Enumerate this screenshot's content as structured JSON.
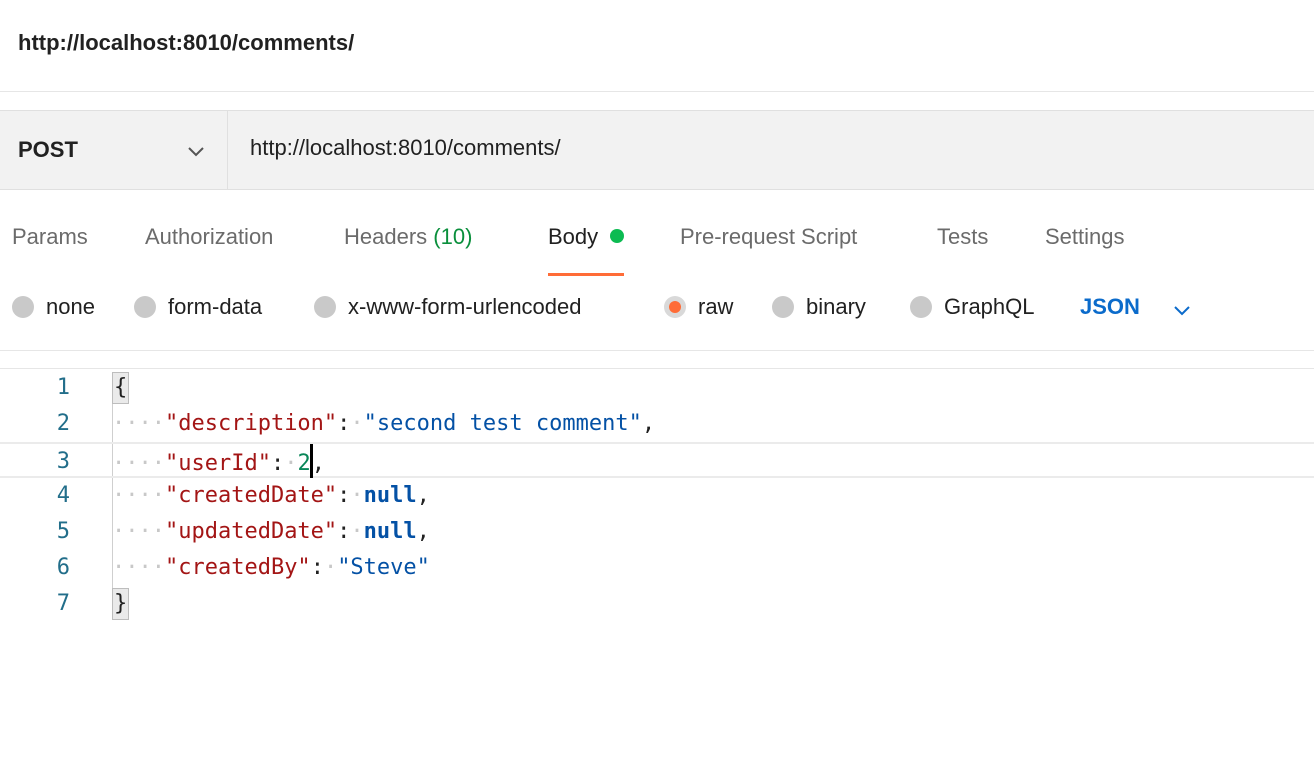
{
  "title": "http://localhost:8010/comments/",
  "request": {
    "method": "POST",
    "url": "http://localhost:8010/comments/"
  },
  "tabs": [
    {
      "label": "Params"
    },
    {
      "label": "Authorization"
    },
    {
      "label": "Headers",
      "count": "(10)"
    },
    {
      "label": "Body",
      "active": true
    },
    {
      "label": "Pre-request Script"
    },
    {
      "label": "Tests"
    },
    {
      "label": "Settings"
    }
  ],
  "body_types": [
    {
      "label": "none"
    },
    {
      "label": "form-data"
    },
    {
      "label": "x-www-form-urlencoded"
    },
    {
      "label": "raw",
      "selected": true
    },
    {
      "label": "binary"
    },
    {
      "label": "GraphQL"
    }
  ],
  "language": "JSON",
  "editor": {
    "line_numbers": [
      "1",
      "2",
      "3",
      "4",
      "5",
      "6",
      "7"
    ],
    "open_brace": "{",
    "close_brace": "}",
    "colon": ":",
    "comma": ",",
    "entries": [
      {
        "key": "\"description\"",
        "value": "\"second test comment\"",
        "type": "string"
      },
      {
        "key": "\"userId\"",
        "value": "2",
        "type": "number"
      },
      {
        "key": "\"createdDate\"",
        "value": "null",
        "type": "keyword"
      },
      {
        "key": "\"updatedDate\"",
        "value": "null",
        "type": "keyword"
      },
      {
        "key": "\"createdBy\"",
        "value": "\"Steve\"",
        "type": "string"
      }
    ]
  },
  "colors": {
    "accent": "#ff6c37",
    "body_indicator": "#0cbb52",
    "link_blue": "#0b6bcb"
  }
}
